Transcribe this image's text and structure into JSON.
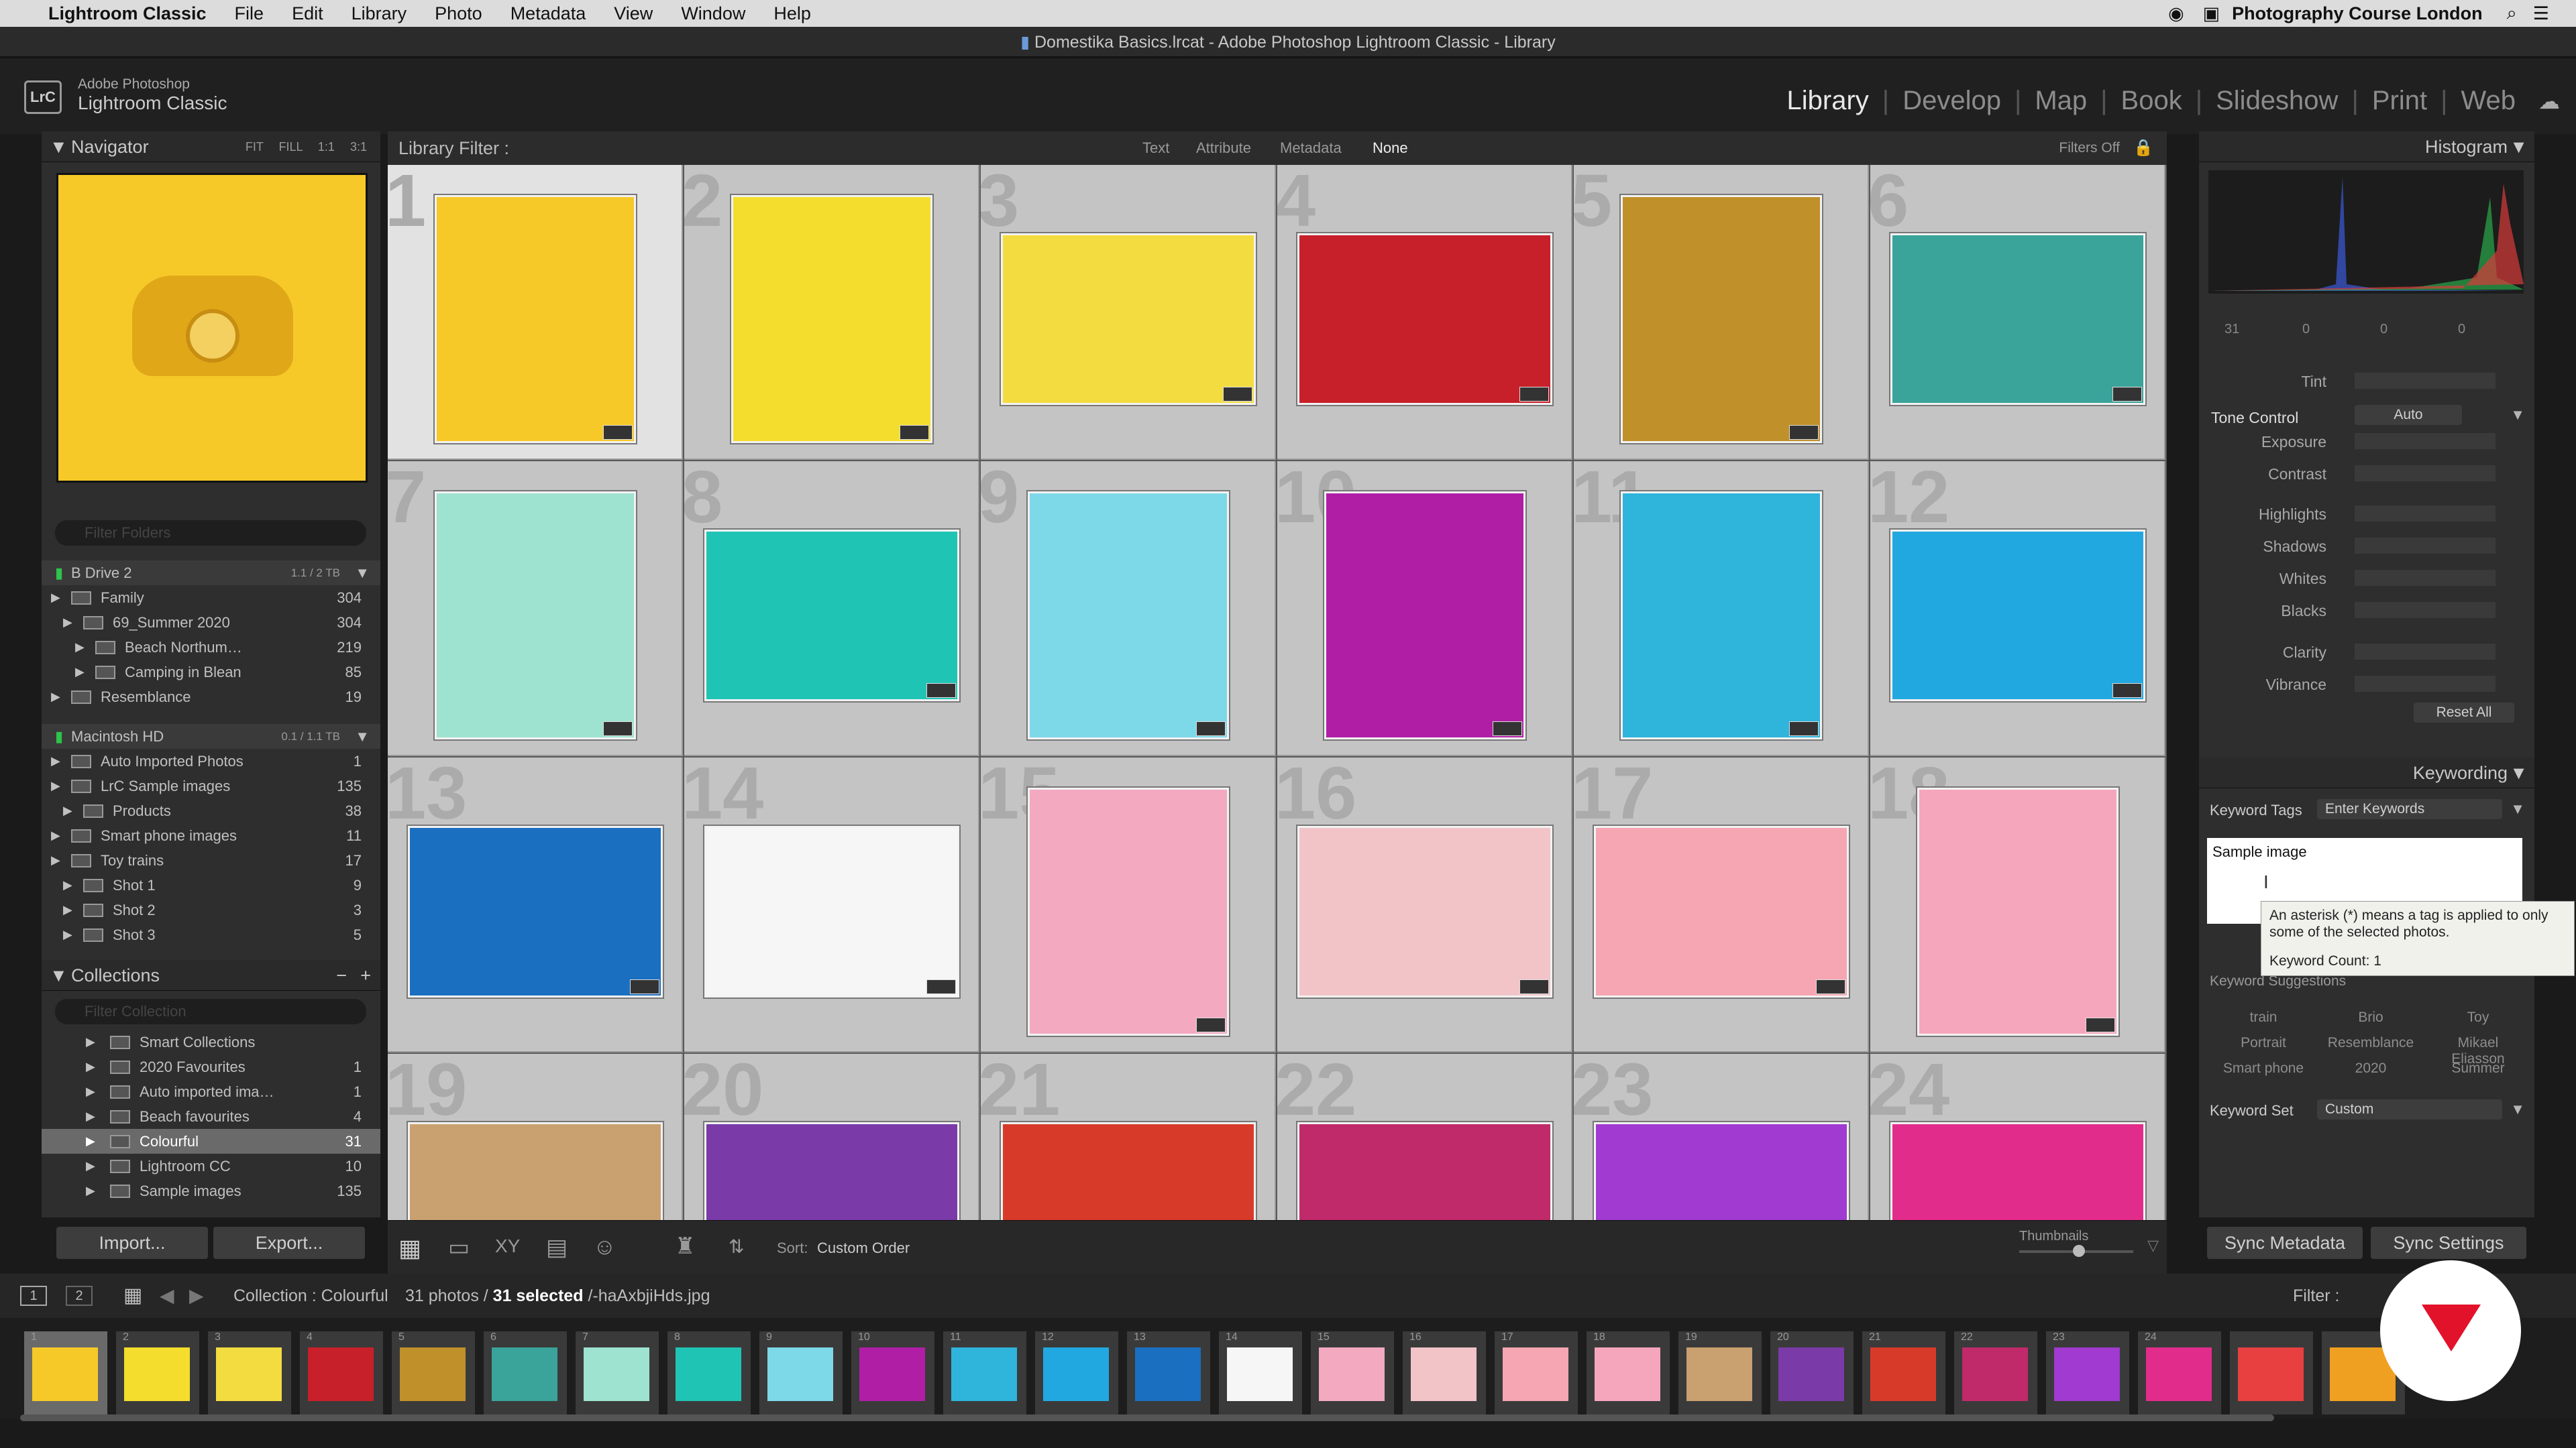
{
  "menubar": {
    "app": "Lightroom Classic",
    "items": [
      "File",
      "Edit",
      "Library",
      "Photo",
      "Metadata",
      "View",
      "Window",
      "Help"
    ],
    "right_text": "Photography Course London"
  },
  "titlebar": {
    "title": "Domestika Basics.lrcat - Adobe Photoshop Lightroom Classic - Library"
  },
  "brand": {
    "line1": "Adobe Photoshop",
    "line2": "Lightroom Classic",
    "badge": "LrC"
  },
  "modules": [
    "Library",
    "Develop",
    "Map",
    "Book",
    "Slideshow",
    "Print",
    "Web"
  ],
  "navigator": {
    "title": "Navigator",
    "zoom": [
      "FIT",
      "FILL",
      "1:1",
      "3:1"
    ]
  },
  "folders": {
    "filter_placeholder": "Filter Folders",
    "volumes": [
      {
        "name": "B Drive 2",
        "info": "1.1 / 2 TB"
      },
      {
        "name": "Macintosh HD",
        "info": "0.1 / 1.1 TB"
      }
    ],
    "b_drive_items": [
      {
        "name": "Family",
        "count": "304",
        "level": 1
      },
      {
        "name": "69_Summer 2020",
        "count": "304",
        "level": 2
      },
      {
        "name": "Beach Northum…",
        "count": "219",
        "level": 3
      },
      {
        "name": "Camping in Blean",
        "count": "85",
        "level": 3
      },
      {
        "name": "Resemblance",
        "count": "19",
        "level": 1
      }
    ],
    "mac_items": [
      {
        "name": "Auto Imported Photos",
        "count": "1",
        "level": 1
      },
      {
        "name": "LrC Sample images",
        "count": "135",
        "level": 1
      },
      {
        "name": "Products",
        "count": "38",
        "level": 2
      },
      {
        "name": "Smart phone images",
        "count": "11",
        "level": 1
      },
      {
        "name": "Toy trains",
        "count": "17",
        "level": 1
      },
      {
        "name": "Shot 1",
        "count": "9",
        "level": 2
      },
      {
        "name": "Shot 2",
        "count": "3",
        "level": 2
      },
      {
        "name": "Shot 3",
        "count": "5",
        "level": 2
      }
    ]
  },
  "collections": {
    "title": "Collections",
    "filter_placeholder": "Filter Collection",
    "items": [
      {
        "name": "Smart Collections",
        "count": ""
      },
      {
        "name": "2020 Favourites",
        "count": "1"
      },
      {
        "name": "Auto imported ima…",
        "count": "1"
      },
      {
        "name": "Beach favourites",
        "count": "4"
      },
      {
        "name": "Colourful",
        "count": "31"
      },
      {
        "name": "Lightroom CC",
        "count": "10"
      },
      {
        "name": "Sample images",
        "count": "135"
      }
    ]
  },
  "left_buttons": {
    "import": "Import...",
    "export": "Export..."
  },
  "library_filter": {
    "label": "Library Filter :",
    "tabs": [
      "Text",
      "Attribute",
      "Metadata",
      "None"
    ],
    "filters_off": "Filters Off"
  },
  "grid_cells": [
    {
      "n": "1",
      "color": "#f6c928"
    },
    {
      "n": "2",
      "color": "#f4dd2c"
    },
    {
      "n": "3",
      "color": "#f3dc40"
    },
    {
      "n": "4",
      "color": "#c8202a"
    },
    {
      "n": "5",
      "color": "#c0902a"
    },
    {
      "n": "6",
      "color": "#3aa39a"
    },
    {
      "n": "7",
      "color": "#9ee3d0"
    },
    {
      "n": "8",
      "color": "#20c4b4"
    },
    {
      "n": "9",
      "color": "#7dd8e8"
    },
    {
      "n": "10",
      "color": "#b11ea6"
    },
    {
      "n": "11",
      "color": "#2fb4dc"
    },
    {
      "n": "12",
      "color": "#22a8e0"
    },
    {
      "n": "13",
      "color": "#1a6fc0"
    },
    {
      "n": "14",
      "color": "#f6f6f6"
    },
    {
      "n": "15",
      "color": "#f3a9c0"
    },
    {
      "n": "16",
      "color": "#f2c4c8"
    },
    {
      "n": "17",
      "color": "#f5a6b2"
    },
    {
      "n": "18",
      "color": "#f6a6bc"
    },
    {
      "n": "19",
      "color": "#c9a070"
    },
    {
      "n": "20",
      "color": "#7a3aa8"
    },
    {
      "n": "21",
      "color": "#d83a2a"
    },
    {
      "n": "22",
      "color": "#c02a6a"
    },
    {
      "n": "23",
      "color": "#a03ad0"
    },
    {
      "n": "24",
      "color": "#e22c8c"
    }
  ],
  "toolbar": {
    "sort_label": "Sort:",
    "sort_value": "Custom Order",
    "thumbnails": "Thumbnails"
  },
  "histogram": {
    "title": "Histogram",
    "values": [
      "31",
      "0",
      "0",
      "0"
    ]
  },
  "quick_develop": {
    "tint": "Tint",
    "tone_control": "Tone Control",
    "auto": "Auto",
    "controls": [
      "Exposure",
      "Contrast",
      "Highlights",
      "Shadows",
      "Whites",
      "Blacks",
      "Clarity",
      "Vibrance"
    ],
    "reset": "Reset All"
  },
  "keywording": {
    "title": "Keywording",
    "tags_label": "Keyword Tags",
    "tags_mode": "Enter Keywords",
    "text": "Sample image",
    "suggestions_title": "Keyword Suggestions",
    "suggestions": [
      "train",
      "Brio",
      "Toy",
      "Portrait",
      "Resemblance",
      "Mikael Eliasson",
      "Smart phone",
      "2020",
      "Summer"
    ],
    "set_label": "Keyword Set",
    "set_value": "Custom"
  },
  "tooltip": {
    "line1": "An asterisk (*) means a tag is applied to only",
    "line2": "some of the selected photos.",
    "line3": "Keyword Count: 1"
  },
  "right_buttons": {
    "sync_metadata": "Sync Metadata",
    "sync_settings": "Sync Settings"
  },
  "filmstrip_bar": {
    "screen1": "1",
    "screen2": "2",
    "source": "Collection : Colourful",
    "count": "31 photos /",
    "selected": "31 selected",
    "file": "/-haAxbjiHds.jpg",
    "filter": "Filter :"
  },
  "filmstrip": [
    {
      "n": "1",
      "color": "#f6c928"
    },
    {
      "n": "2",
      "color": "#f4dd2c"
    },
    {
      "n": "3",
      "color": "#f3dc40"
    },
    {
      "n": "4",
      "color": "#c8202a"
    },
    {
      "n": "5",
      "color": "#c0902a"
    },
    {
      "n": "6",
      "color": "#3aa39a"
    },
    {
      "n": "7",
      "color": "#9ee3d0"
    },
    {
      "n": "8",
      "color": "#20c4b4"
    },
    {
      "n": "9",
      "color": "#7dd8e8"
    },
    {
      "n": "10",
      "color": "#b11ea6"
    },
    {
      "n": "11",
      "color": "#2fb4dc"
    },
    {
      "n": "12",
      "color": "#22a8e0"
    },
    {
      "n": "13",
      "color": "#1a6fc0"
    },
    {
      "n": "14",
      "color": "#f6f6f6"
    },
    {
      "n": "15",
      "color": "#f3a9c0"
    },
    {
      "n": "16",
      "color": "#f2c4c8"
    },
    {
      "n": "17",
      "color": "#f5a6b2"
    },
    {
      "n": "18",
      "color": "#f6a6bc"
    },
    {
      "n": "19",
      "color": "#c9a070"
    },
    {
      "n": "20",
      "color": "#7a3aa8"
    },
    {
      "n": "21",
      "color": "#d83a2a"
    },
    {
      "n": "22",
      "color": "#c02a6a"
    },
    {
      "n": "23",
      "color": "#a03ad0"
    },
    {
      "n": "24",
      "color": "#e22c8c"
    },
    {
      "n": "",
      "color": "#e84040"
    },
    {
      "n": "",
      "color": "#f0a020"
    }
  ]
}
